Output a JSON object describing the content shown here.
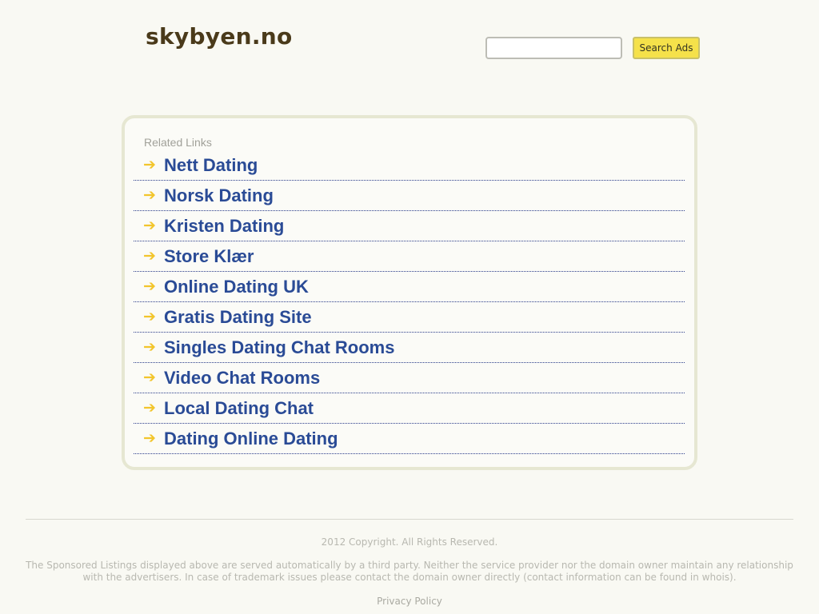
{
  "header": {
    "site_title": "skybyen.no",
    "search": {
      "value": "",
      "placeholder": "",
      "button_label": "Search Ads"
    }
  },
  "related": {
    "label": "Related Links",
    "links": [
      {
        "label": "Nett Dating"
      },
      {
        "label": "Norsk Dating"
      },
      {
        "label": "Kristen Dating"
      },
      {
        "label": "Store Klær"
      },
      {
        "label": "Online Dating UK"
      },
      {
        "label": "Gratis Dating Site"
      },
      {
        "label": "Singles Dating Chat Rooms"
      },
      {
        "label": "Video Chat Rooms"
      },
      {
        "label": "Local Dating Chat"
      },
      {
        "label": "Dating Online Dating"
      }
    ],
    "arrow_icon": "arrow-right-icon",
    "arrow_glyph": "➔"
  },
  "footer": {
    "copyright": "2012 Copyright. All Rights Reserved.",
    "disclaimer": "The Sponsored Listings displayed above are served automatically by a third party. Neither the service provider nor the domain owner maintain any relationship with the advertisers. In case of trademark issues please contact the domain owner directly (contact information can be found in whois).",
    "privacy_label": "Privacy Policy"
  },
  "colors": {
    "background": "#f9f9f3",
    "title": "#4a3a1a",
    "link": "#2a4b96",
    "arrow": "#f2c52c",
    "button": "#f5e14a",
    "box_border": "#e6e7d2"
  }
}
